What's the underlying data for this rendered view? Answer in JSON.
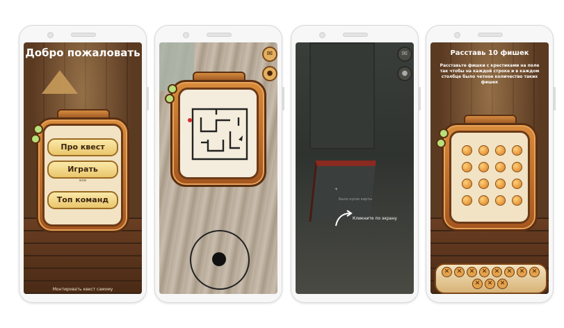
{
  "screen1": {
    "title": "Добро пожаловать",
    "buttons": [
      "Про квест",
      "Играть",
      "Топ команд"
    ],
    "divider_label": "или",
    "footer_text": "Монтировать квест самому"
  },
  "screen2": {
    "mail_icon": "mail-icon",
    "pin_icon": "location-pin-icon",
    "joystick_icon": "joystick-knob"
  },
  "screen3": {
    "mail_icon": "mail-icon",
    "pin_icon": "location-pin-icon",
    "ar_hint": "Было  нусок  карты",
    "tap_hint": "Кликните по экрану"
  },
  "screen4": {
    "title": "Расставь 10 фишек",
    "instructions": "Расставьте фишки с крестиками на поле так чтобы на каждой строке и в каждом столбце было четное количество таких фишек",
    "x_glyph": "✕"
  },
  "colors": {
    "accent": "#d98b3b",
    "wood": "#5b3a22",
    "gold": "#e9c66b",
    "chip": "#d77b1e"
  }
}
